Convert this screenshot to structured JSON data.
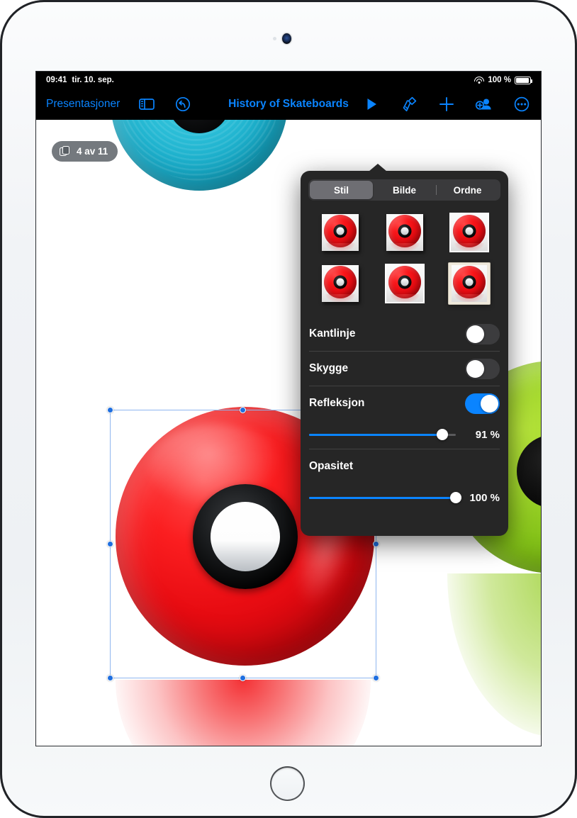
{
  "status_bar": {
    "time": "09:41",
    "date": "tir. 10. sep.",
    "battery_percent": "100 %",
    "wifi_icon": "wifi-icon",
    "battery_icon": "battery-icon"
  },
  "toolbar": {
    "back_label": "Presentasjoner",
    "sidebar_icon": "sidebar-icon",
    "undo_icon": "undo-icon",
    "document_title": "History of Skateboards",
    "play_icon": "play-icon",
    "format_brush_icon": "format-brush-icon",
    "insert_icon": "plus-icon",
    "collaborate_icon": "add-person-icon",
    "more_icon": "more-ellipsis-icon"
  },
  "canvas": {
    "slide_badge": {
      "icon": "slide-stack-icon",
      "label": "4 av 11"
    }
  },
  "popover": {
    "tabs": [
      {
        "label": "Stil",
        "active": true
      },
      {
        "label": "Bilde",
        "active": false
      },
      {
        "label": "Ordne",
        "active": false
      }
    ],
    "styles": [
      {
        "name": "style-1",
        "selected": false,
        "variant": "shadow"
      },
      {
        "name": "style-2",
        "selected": false,
        "variant": "shadow"
      },
      {
        "name": "style-3",
        "selected": false,
        "variant": "border"
      },
      {
        "name": "style-4",
        "selected": false,
        "variant": "shadow"
      },
      {
        "name": "style-5",
        "selected": false,
        "variant": "border"
      },
      {
        "name": "style-6",
        "selected": true,
        "variant": "mat"
      }
    ],
    "rows": [
      {
        "label": "Kantlinje",
        "toggle_on": false
      },
      {
        "label": "Skygge",
        "toggle_on": false
      },
      {
        "label": "Refleksjon",
        "toggle_on": true
      }
    ],
    "reflection_slider": {
      "value": "91 %",
      "percent": 91
    },
    "opacity_label": "Opasitet",
    "opacity_slider": {
      "value": "100 %",
      "percent": 100
    }
  },
  "colors": {
    "accent_blue": "#0a84ff",
    "popover_bg": "#262626",
    "segment_bg": "#3a3a3c",
    "segment_active": "#6e6e73",
    "toggle_off": "#3c3c3e",
    "selection_blue": "#1f6fe0",
    "wheel_red": "#e80c12",
    "wheel_cyan": "#29bcd6",
    "wheel_green": "#9ed42a"
  }
}
